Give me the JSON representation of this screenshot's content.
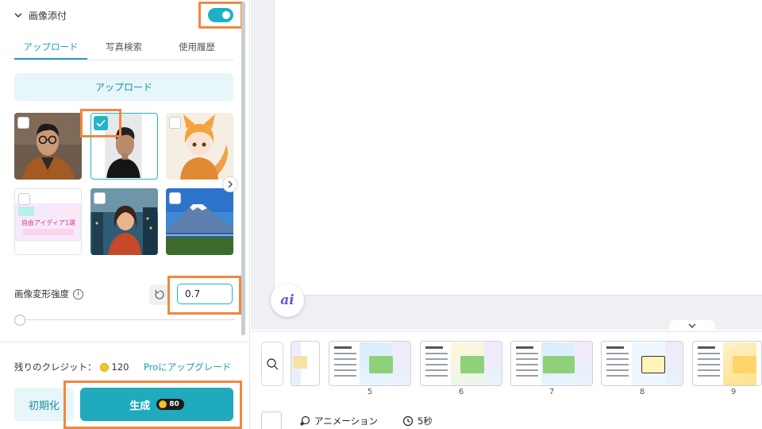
{
  "image_attach": {
    "title": "画像添付",
    "enabled": true
  },
  "tabs": [
    {
      "label": "アップロード",
      "active": true
    },
    {
      "label": "写真検索",
      "active": false
    },
    {
      "label": "使用履歴",
      "active": false
    }
  ],
  "upload_button": "アップロード",
  "thumbnails": [
    {
      "name": "man-glasses-photo",
      "selected": false
    },
    {
      "name": "man-side-profile-photo",
      "selected": true
    },
    {
      "name": "fox-girl-illustration",
      "selected": false
    },
    {
      "name": "banner-image",
      "selected": false,
      "caption": "自由アイディア1選"
    },
    {
      "name": "city-woman-illustration",
      "selected": false
    },
    {
      "name": "mount-fuji-photo",
      "selected": false
    }
  ],
  "transform_strength": {
    "label": "画像変形強度",
    "value": "0.7",
    "slider_fraction": 0.0
  },
  "credits": {
    "label": "残りのクレジット：",
    "amount": "120"
  },
  "upgrade_link": "Proにアップグレード",
  "buttons": {
    "reset": "初期化",
    "generate": "生成",
    "generate_cost": "80"
  },
  "filmstrip": {
    "slides": [
      {
        "number": "5"
      },
      {
        "number": "6"
      },
      {
        "number": "7"
      },
      {
        "number": "8"
      },
      {
        "number": "9"
      }
    ]
  },
  "bottom_toolbar": {
    "animation": "アニメーション",
    "duration": "5秒"
  },
  "colors": {
    "accent": "#20aabd",
    "highlight_frame": "#f0883e"
  }
}
